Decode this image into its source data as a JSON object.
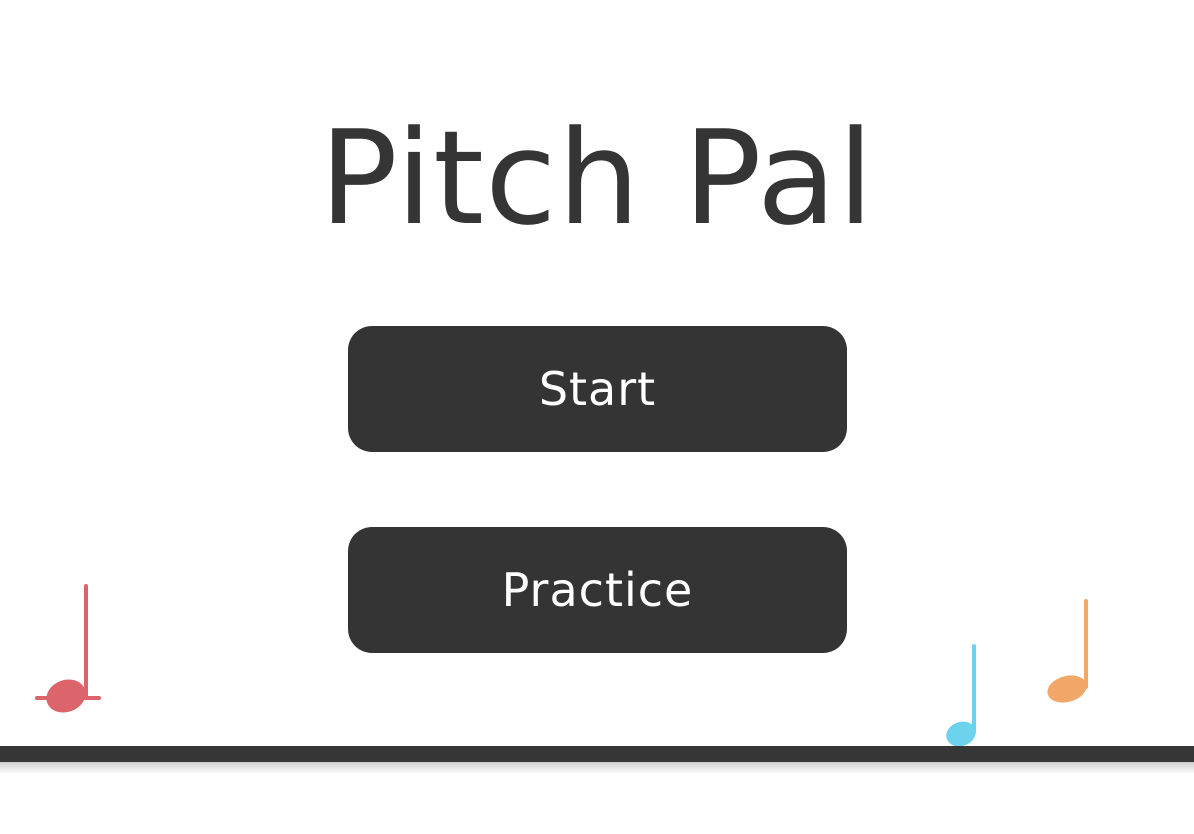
{
  "app": {
    "title": "Pitch Pal"
  },
  "menu": {
    "start_label": "Start",
    "practice_label": "Practice"
  },
  "colors": {
    "background": "#ffffff",
    "text": "#353535",
    "button": "#343434",
    "button_text": "#ffffff",
    "ground": "#363636",
    "note_red": "#dc646b",
    "note_blue": "#6dd2ee",
    "note_orange": "#f0a768"
  },
  "icons": {
    "note_left": "music-note-icon",
    "note_middle": "music-note-icon",
    "note_right": "music-note-icon"
  }
}
